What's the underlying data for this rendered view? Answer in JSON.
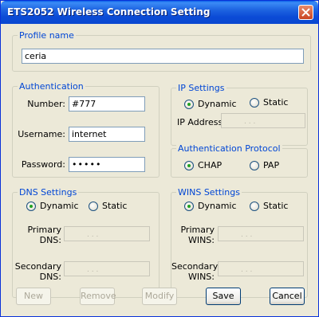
{
  "window": {
    "title": "ETS2052 Wireless Connection Setting"
  },
  "profile": {
    "group_title": "Profile name",
    "value": "ceria"
  },
  "auth": {
    "group_title": "Authentication",
    "number_label": "Number:",
    "number_value": "#777",
    "username_label": "Username:",
    "username_value": "internet",
    "password_label": "Password:",
    "password_value": "•••••"
  },
  "ip": {
    "group_title": "IP Settings",
    "dynamic": "Dynamic",
    "static": "Static",
    "address_label": "IP Address:",
    "selected": "dynamic"
  },
  "auth_protocol": {
    "group_title": "Authentication Protocol",
    "chap": "CHAP",
    "pap": "PAP",
    "selected": "chap"
  },
  "dns": {
    "group_title": "DNS Settings",
    "dynamic": "Dynamic",
    "static": "Static",
    "primary_l1": "Primary",
    "primary_l2": "DNS:",
    "secondary_l1": "Secondary",
    "secondary_l2": "DNS:",
    "selected": "dynamic"
  },
  "wins": {
    "group_title": "WINS Settings",
    "dynamic": "Dynamic",
    "static": "Static",
    "primary_l1": "Primary",
    "primary_l2": "WINS:",
    "secondary_l1": "Secondary",
    "secondary_l2": "WINS:",
    "selected": "dynamic"
  },
  "buttons": {
    "new": "New",
    "remove": "Remove",
    "modify": "Modify",
    "save": "Save",
    "cancel": "Cancel"
  },
  "ip_dots": ". . ."
}
